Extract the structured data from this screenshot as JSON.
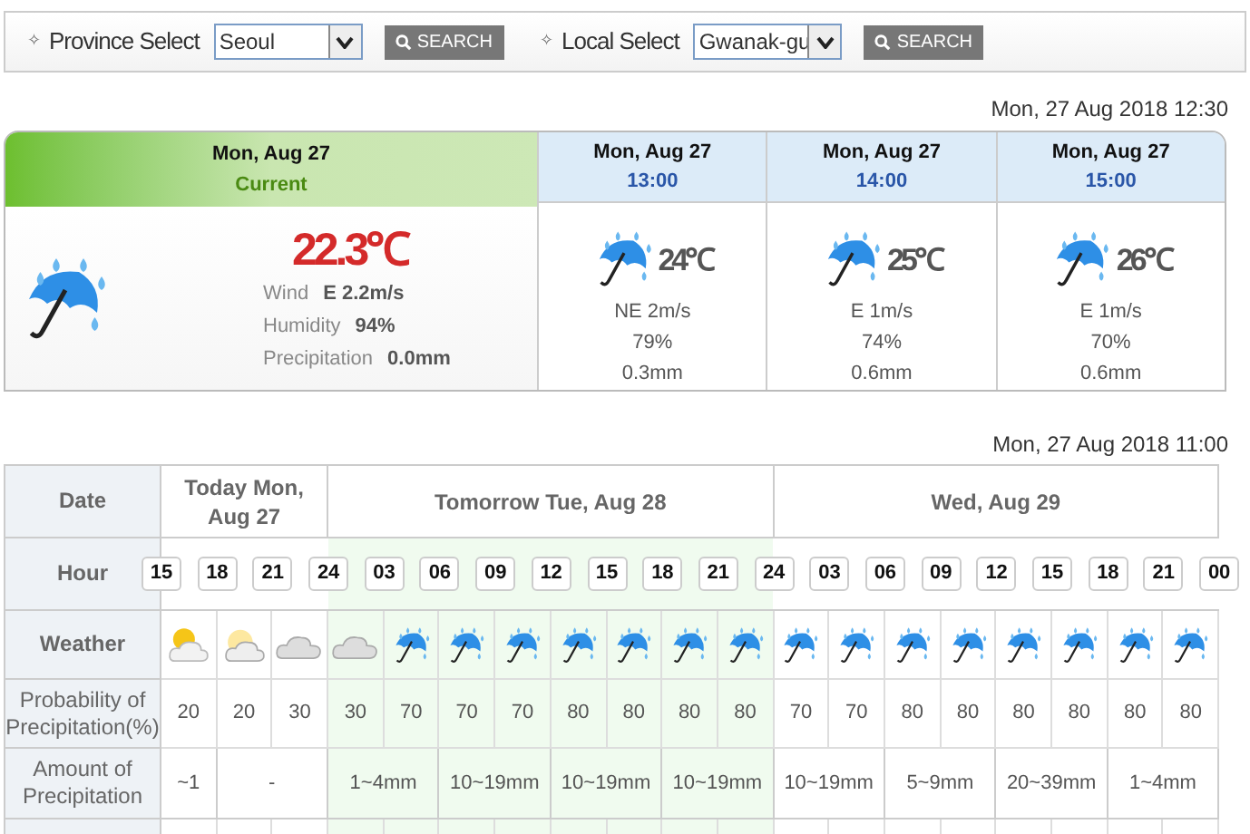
{
  "search_bar": [
    {
      "bullet": "✧",
      "label": "Province Select",
      "value": "Seoul",
      "button": "SEARCH"
    },
    {
      "bullet": "✧",
      "label": "Local Select",
      "value": "Gwanak-gu",
      "button": "SEARCH"
    }
  ],
  "current_timestamp": "Mon, 27 Aug 2018 12:30",
  "current": {
    "date": "Mon, Aug 27",
    "label": "Current",
    "temperature": "22.3℃",
    "kind": "rain",
    "details": [
      {
        "label": "Wind",
        "value": "E 2.2m/s"
      },
      {
        "label": "Humidity",
        "value": "94%"
      },
      {
        "label": "Precipitation",
        "value": "0.0mm"
      }
    ]
  },
  "hourly": [
    {
      "date": "Mon, Aug 27",
      "time": "13:00",
      "kind": "rain",
      "temperature": "24℃",
      "wind": "NE 2m/s",
      "humidity": "79%",
      "precipitation": "0.3mm"
    },
    {
      "date": "Mon, Aug 27",
      "time": "14:00",
      "kind": "rain",
      "temperature": "25℃",
      "wind": "E 1m/s",
      "humidity": "74%",
      "precipitation": "0.6mm"
    },
    {
      "date": "Mon, Aug 27",
      "time": "15:00",
      "kind": "rain",
      "temperature": "26℃",
      "wind": "E 1m/s",
      "humidity": "70%",
      "precipitation": "0.6mm"
    }
  ],
  "forecast_timestamp": "Mon, 27 Aug 2018 11:00",
  "forecast": {
    "row_labels": [
      "Date",
      "Hour",
      "Weather",
      "Probability of Precipitation(%)",
      "Amount of Precipitation"
    ],
    "hours": [
      "15",
      "18",
      "21",
      "24",
      "03",
      "06",
      "09",
      "12",
      "15",
      "18",
      "21",
      "24",
      "03",
      "06",
      "09",
      "12",
      "15",
      "18",
      "21",
      "00"
    ],
    "days": [
      {
        "label": "Today Mon, Aug 27",
        "highlighted": false,
        "slots": [
          {
            "kind": "sun-cloud",
            "probability": "20"
          },
          {
            "kind": "partly-cloudy",
            "probability": "20"
          },
          {
            "kind": "cloudy",
            "probability": "30"
          }
        ],
        "amounts": [
          {
            "text": "~1",
            "wide": false
          },
          {
            "text": "-",
            "wide": true
          }
        ]
      },
      {
        "label": "Tomorrow Tue, Aug 28",
        "highlighted": true,
        "slots": [
          {
            "kind": "cloudy",
            "probability": "30"
          },
          {
            "kind": "rain",
            "probability": "70"
          },
          {
            "kind": "rain",
            "probability": "70"
          },
          {
            "kind": "rain",
            "probability": "70"
          },
          {
            "kind": "rain",
            "probability": "80"
          },
          {
            "kind": "rain",
            "probability": "80"
          },
          {
            "kind": "rain",
            "probability": "80"
          },
          {
            "kind": "rain",
            "probability": "80"
          }
        ],
        "amounts": [
          {
            "text": "1~4mm",
            "wide": true
          },
          {
            "text": "10~19mm",
            "wide": true
          },
          {
            "text": "10~19mm",
            "wide": true
          },
          {
            "text": "10~19mm",
            "wide": true
          }
        ]
      },
      {
        "label": "Wed, Aug 29",
        "highlighted": false,
        "slots": [
          {
            "kind": "rain",
            "probability": "70"
          },
          {
            "kind": "rain",
            "probability": "70"
          },
          {
            "kind": "rain",
            "probability": "80"
          },
          {
            "kind": "rain",
            "probability": "80"
          },
          {
            "kind": "rain",
            "probability": "80"
          },
          {
            "kind": "rain",
            "probability": "80"
          },
          {
            "kind": "rain",
            "probability": "80"
          },
          {
            "kind": "rain",
            "probability": "80"
          }
        ],
        "amounts": [
          {
            "text": "10~19mm",
            "wide": true
          },
          {
            "text": "5~9mm",
            "wide": true
          },
          {
            "text": "20~39mm",
            "wide": true
          },
          {
            "text": "1~4mm",
            "wide": true
          }
        ]
      }
    ]
  }
}
